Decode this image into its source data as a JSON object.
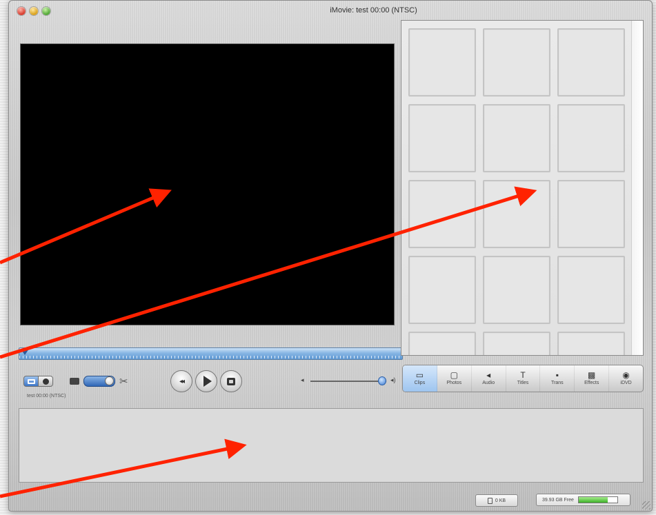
{
  "window": {
    "title": "iMovie: test  00:00 (NTSC)"
  },
  "monitor": {
    "status_text": "test  00:00 (NTSC)"
  },
  "mode_switch": {
    "camera_icon": "camera-icon",
    "clock_icon": "clock-icon"
  },
  "edit_controls": {
    "scissors_glyph": "✂"
  },
  "transport": {
    "rewind_glyph": "◂◂",
    "play_icon": "play-icon",
    "fullscreen_icon": "fullscreen-icon"
  },
  "volume": {
    "low_glyph": "◂",
    "high_glyph": "◂)",
    "level": 0.9
  },
  "pane_tabs": [
    {
      "label": "Clips",
      "glyph": "▭",
      "icon": "clips-icon"
    },
    {
      "label": "Photos",
      "glyph": "▢",
      "icon": "photos-icon"
    },
    {
      "label": "Audio",
      "glyph": "◂",
      "icon": "audio-icon"
    },
    {
      "label": "Titles",
      "glyph": "T",
      "icon": "titles-icon"
    },
    {
      "label": "Trans",
      "glyph": "▪",
      "icon": "transitions-icon"
    },
    {
      "label": "Effects",
      "glyph": "▩",
      "icon": "effects-icon"
    },
    {
      "label": "iDVD",
      "glyph": "◉",
      "icon": "idvd-icon"
    }
  ],
  "clip_shelf": {
    "columns": 3,
    "cells": 15
  },
  "footer": {
    "trash_size": "0 KB",
    "disk_free": "39.93 GB Free",
    "disk_free_fraction": 0.75
  },
  "colors": {
    "arrow": "#ff2200",
    "accent_blue": "#3d76c8"
  }
}
